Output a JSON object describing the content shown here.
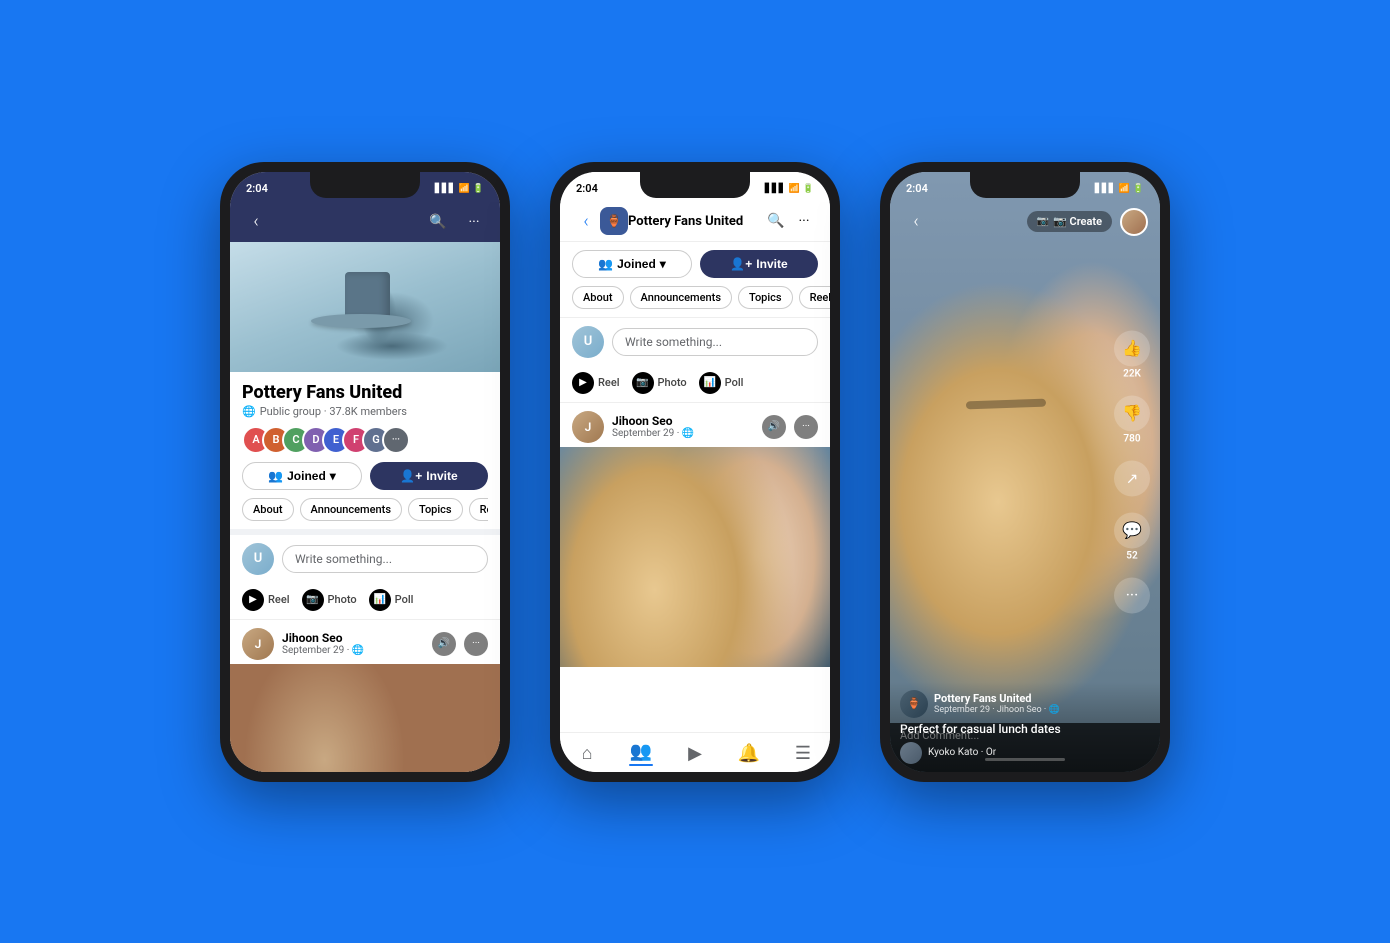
{
  "bg_color": "#1877F2",
  "phones": [
    {
      "id": "phone1",
      "status_time": "2:04",
      "header": {
        "back_label": "‹",
        "search_label": "🔍",
        "more_label": "···"
      },
      "cover": {},
      "group": {
        "name": "Pottery Fans United",
        "meta": "Public group · 37.8K members",
        "member_colors": [
          "#e05050",
          "#d06030",
          "#50a060",
          "#8060b0",
          "#4060d0",
          "#d04070",
          "#606060",
          "#808080"
        ],
        "member_labels": [
          "A",
          "B",
          "C",
          "D",
          "E",
          "F",
          "G",
          "···"
        ]
      },
      "buttons": {
        "joined": "Joined",
        "invite": "Invite"
      },
      "tabs": [
        "About",
        "Announcements",
        "Topics",
        "Reels"
      ],
      "write_placeholder": "Write something...",
      "post_actions": [
        "Reel",
        "Photo",
        "Poll"
      ],
      "post": {
        "author": "Jihoon Seo",
        "date": "September 29 · 🌐"
      }
    },
    {
      "id": "phone2",
      "status_time": "2:04",
      "header": {
        "back_label": "‹",
        "group_name": "Pottery Fans United",
        "search_label": "🔍",
        "more_label": "···"
      },
      "buttons": {
        "joined": "Joined",
        "invite": "Invite"
      },
      "tabs": [
        "About",
        "Announcements",
        "Topics",
        "Reels"
      ],
      "write_placeholder": "Write something...",
      "post_actions": [
        "Reel",
        "Photo",
        "Poll"
      ],
      "post": {
        "author": "Jihoon Seo",
        "date": "September 29 · 🌐"
      }
    },
    {
      "id": "phone3",
      "status_time": "2:04",
      "header": {
        "back_label": "‹",
        "create_label": "📷 Create"
      },
      "overlay": {
        "like_count": "22K",
        "dislike_count": "780",
        "share_label": "↗",
        "comment_count": "52",
        "more_label": "···"
      },
      "video_bottom": {
        "group_name": "Pottery Fans United",
        "group_sub": "September 29 · Jihoon Seo · 🌐",
        "caption": "Perfect for casual lunch dates",
        "commenter": "Kyoko Kato · Or",
        "add_comment": "Add Comment..."
      }
    }
  ]
}
